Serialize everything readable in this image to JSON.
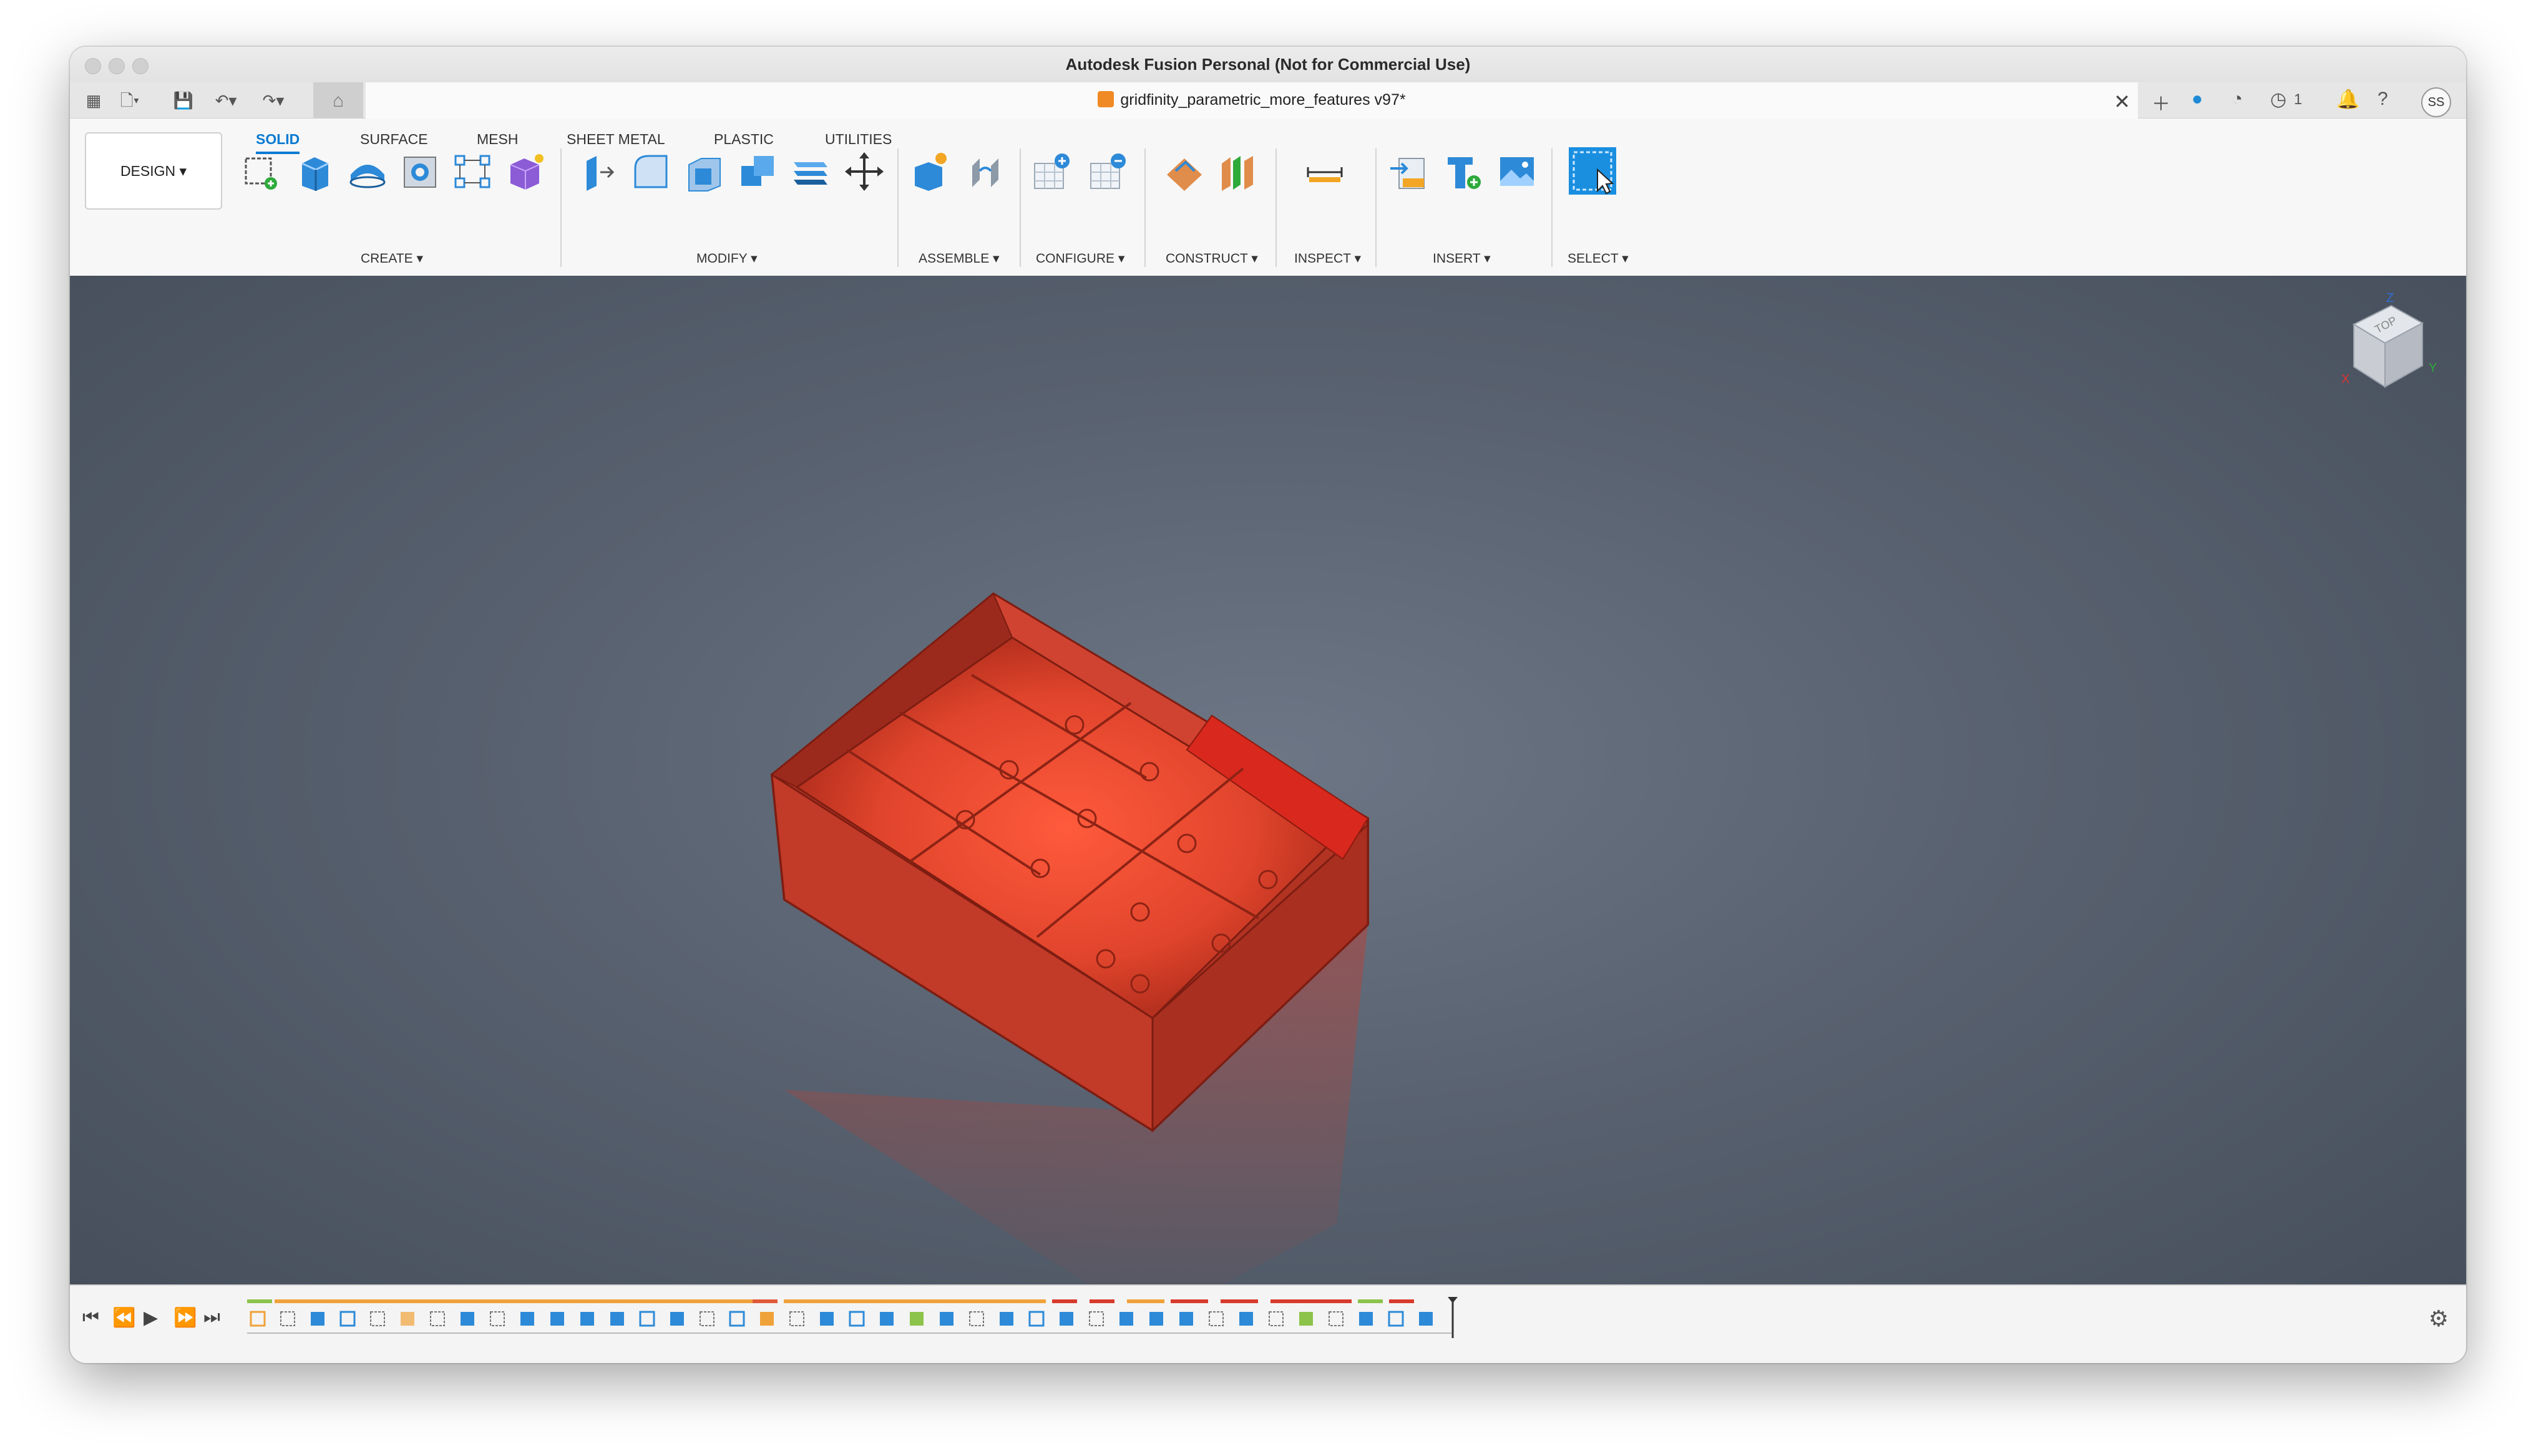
{
  "window": {
    "title": "Autodesk Fusion Personal (Not for Commercial Use)"
  },
  "tabs": {
    "document_name": "gridfinity_parametric_more_features v97*",
    "jobs_count": "1",
    "user_initials": "SS"
  },
  "toolbar": {
    "workspace": "DESIGN",
    "ribbon_tabs": [
      "SOLID",
      "SURFACE",
      "MESH",
      "SHEET METAL",
      "PLASTIC",
      "UTILITIES"
    ],
    "active_tab": "SOLID",
    "groups": [
      "CREATE",
      "MODIFY",
      "ASSEMBLE",
      "CONFIGURE",
      "CONSTRUCT",
      "INSPECT",
      "INSERT",
      "SELECT"
    ]
  },
  "viewcube": {
    "face_label": "TOP",
    "axes": [
      "X",
      "Y",
      "Z"
    ]
  },
  "colors": {
    "accent": "#0b7ad1",
    "model": "#c8392b",
    "viewport_bg": "#58616f"
  },
  "icons": {
    "sketch": "create-sketch-icon",
    "extrude": "extrude-icon",
    "revolve": "revolve-icon",
    "hole": "hole-icon",
    "pattern": "pattern-icon",
    "form": "create-form-icon"
  }
}
